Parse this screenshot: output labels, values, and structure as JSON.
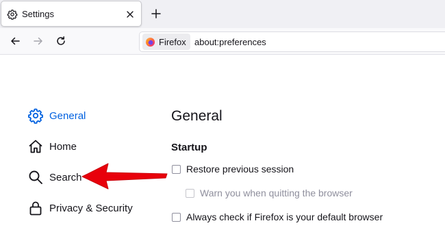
{
  "window": {
    "tab_title": "Settings",
    "tab_icon": "gear-icon",
    "new_tab_icon": "plus-icon"
  },
  "navbar": {
    "identity_label": "Firefox",
    "url": "about:preferences"
  },
  "sidebar": {
    "items": [
      {
        "label": "General",
        "icon": "gear-icon",
        "active": true
      },
      {
        "label": "Home",
        "icon": "home-icon",
        "active": false
      },
      {
        "label": "Search",
        "icon": "search-icon",
        "active": false
      },
      {
        "label": "Privacy & Security",
        "icon": "lock-icon",
        "active": false
      }
    ]
  },
  "main": {
    "title": "General",
    "startup": {
      "heading": "Startup",
      "options": [
        {
          "label": "Restore previous session",
          "checked": false,
          "disabled": false
        },
        {
          "label": "Warn you when quitting the browser",
          "checked": false,
          "disabled": true
        },
        {
          "label": "Always check if Firefox is your default browser",
          "checked": false,
          "disabled": false
        }
      ]
    }
  },
  "colors": {
    "accent": "#0061e0",
    "annotation_arrow": "#e8000b"
  }
}
